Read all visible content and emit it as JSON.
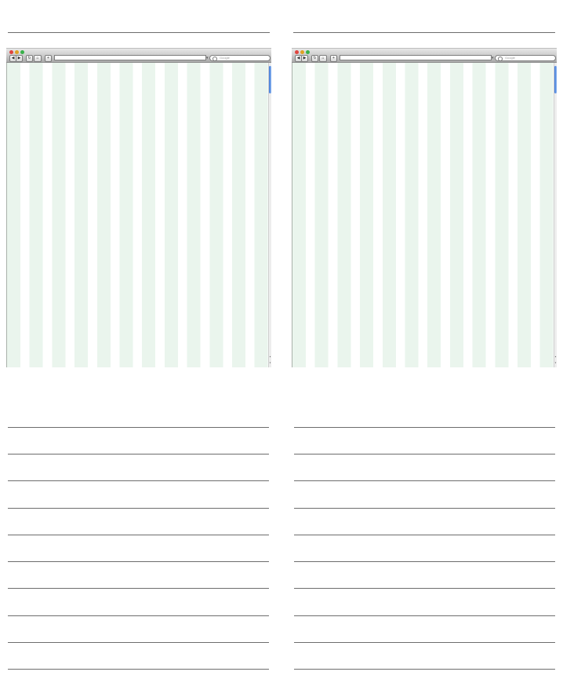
{
  "browsers": [
    {
      "id": "left",
      "search_placeholder": "Google",
      "toolbar": {
        "back": "◀",
        "forward": "▶",
        "reload": "↻",
        "home": "⌂",
        "add": "+"
      },
      "scroll_position": 0.0
    },
    {
      "id": "right",
      "search_placeholder": "Google",
      "toolbar": {
        "back": "◀",
        "forward": "▶",
        "reload": "↻",
        "home": "⌂",
        "add": "+"
      },
      "scroll_position": 0.0
    }
  ],
  "colors": {
    "grid_column": "#eaf5ed",
    "rule": "#6d6d6d",
    "scroll_thumb": "#3d78d8"
  },
  "icons": [
    "close-light",
    "minimize-light",
    "maximize-light",
    "back-icon",
    "forward-icon",
    "reload-icon",
    "home-icon",
    "add-icon",
    "search-icon",
    "dropdown-caret-icon",
    "scroll-up-icon",
    "scroll-down-icon"
  ]
}
